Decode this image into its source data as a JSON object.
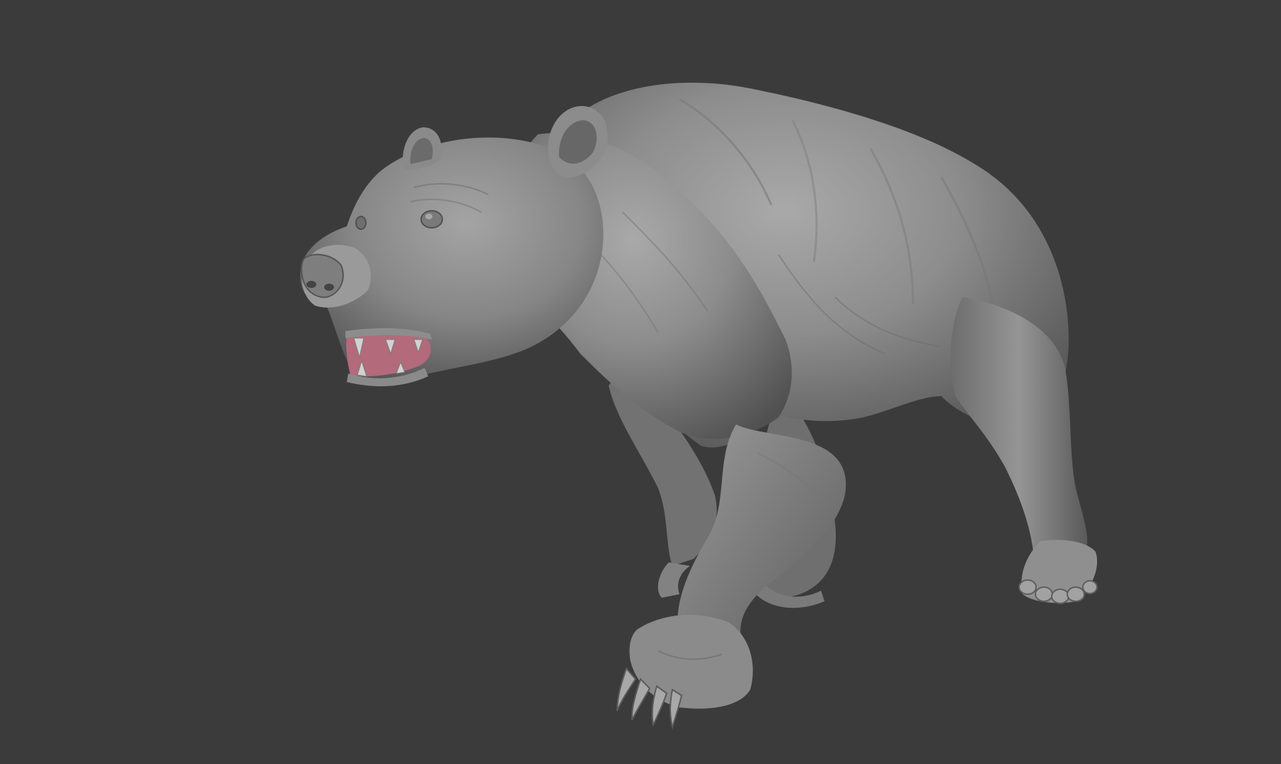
{
  "scene": {
    "subject": "bear-sculpt",
    "background_color": "#3b3b3b",
    "model_base_color": "#8d8d8d",
    "model_shadow_color": "#4f4f4f",
    "model_highlight_color": "#b8b8b8",
    "mouth_color": "#b36a7b",
    "teeth_color": "#cfcfcf"
  }
}
